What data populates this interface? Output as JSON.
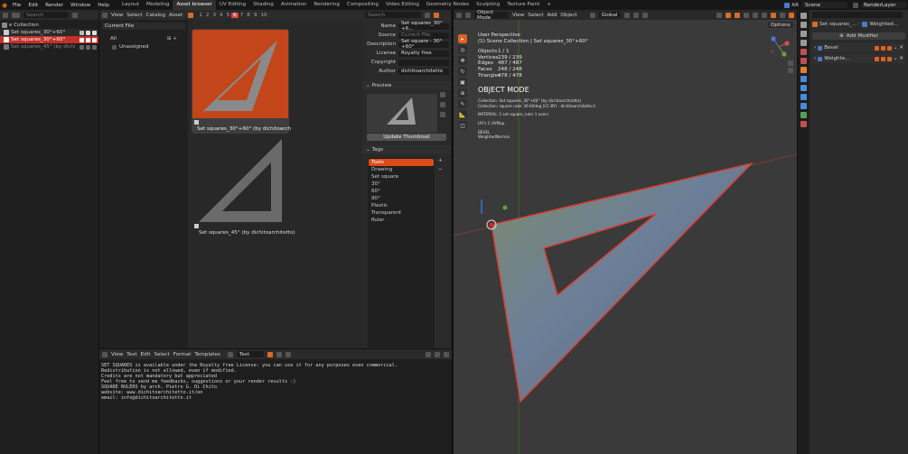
{
  "topbar": {
    "menus": [
      "File",
      "Edit",
      "Render",
      "Window",
      "Help"
    ],
    "workspaces": [
      "Layout",
      "Modeling",
      "Asset browser",
      "UV Editing",
      "Shading",
      "Animation",
      "Rendering",
      "Compositing",
      "Video Editing",
      "Geometry Nodes",
      "Sculpting",
      "Texture Paint"
    ],
    "active_workspace": "Asset browser",
    "scene": "Scene",
    "render_layer": "RenderLayer",
    "scene_prefix": "AR"
  },
  "outliner": {
    "root": "e Collection",
    "items": [
      "Set squares_30°+60°",
      "Set squares_30°+60°",
      "Set squares_45° (by dichi"
    ],
    "search_placeholder": "Search"
  },
  "asset_browser": {
    "menus": [
      "View",
      "Select",
      "Catalog",
      "Asset"
    ],
    "library": "Current File",
    "catalogs": [
      "All",
      "Unassigned"
    ],
    "frame_numbers": [
      "1",
      "2",
      "3",
      "4",
      "5",
      "6",
      "7",
      "8",
      "9",
      "10"
    ],
    "search_placeholder": "Search",
    "assets": [
      {
        "name": "Set squares_30°+60° (by dichitoarchitetto)",
        "selected": true
      },
      {
        "name": "Set squares_45° (by dichitoarchitetto)",
        "selected": false
      }
    ]
  },
  "metadata": {
    "fields": [
      {
        "label": "Name",
        "value": "Set squares_30°+6..."
      },
      {
        "label": "Source",
        "value": "Current File"
      },
      {
        "label": "Description",
        "value": "Set square - 30°+60°"
      },
      {
        "label": "License",
        "value": "Royalty free"
      },
      {
        "label": "Copyright",
        "value": ""
      },
      {
        "label": "Author",
        "value": "dichitoarchitetto"
      }
    ],
    "preview_title": "Preview",
    "update_thumbnail": "Update Thumbnail",
    "tags_title": "Tags",
    "tags": [
      "Tools",
      "Drawing",
      "Set square",
      "30°",
      "60°",
      "90°",
      "Plastic",
      "Transparent",
      "Ruler"
    ],
    "active_tag": "Tools"
  },
  "text_editor": {
    "menus": [
      "View",
      "Text",
      "Edit",
      "Select",
      "Format",
      "Templates"
    ],
    "file": "Text",
    "lines": [
      "SET SQUARES is available under the Royalty free License: you can use it for any purposes even commercial.",
      "Redistribution is not allowed, even if modified.",
      "",
      "Credits are not mandatory but appreciated",
      "",
      "Feel free to send me feedbacks, suggestions or your render results :)",
      "",
      "SQUARE RULERS by arch. Pietro G. Di Chito",
      "website: www.dichitoarchitetto.it/en",
      "email: info@dichitoarchitetto.it"
    ]
  },
  "viewport": {
    "mode": "Object Mode",
    "menus": [
      "View",
      "Select",
      "Add",
      "Object"
    ],
    "orientation": "Global",
    "options": "Options",
    "perspective": "User Perspective",
    "collection": "(1) Scene Collection | Set squares_30°+60°",
    "stats": [
      {
        "label": "Objects",
        "value": "1 / 1"
      },
      {
        "label": "Vertices",
        "value": "239 / 239"
      },
      {
        "label": "Edges",
        "value": "487 / 487"
      },
      {
        "label": "Faces",
        "value": "248 / 248"
      },
      {
        "label": "Triangles",
        "value": "478 / 478"
      }
    ],
    "mode_title": "OBJECT MODE",
    "info_lines": [
      "Collection: Set squares_30°+60° (by dichitoarchitetto)",
      "Collection: square ruler 30-60deg [CC-BY] - dichitoarchitetto.it",
      "",
      "MATERIAL: 1 set square_ruler 1 users",
      "",
      "UV's 1 UVMap",
      "",
      "BEVEL",
      "WeightedNormal"
    ]
  },
  "properties": {
    "object": "Set squares_...",
    "modifier": "Weighted...",
    "add_modifier": "Add Modifier",
    "modifiers": [
      "Bevel",
      "Weighte..."
    ]
  },
  "colors": {
    "accent": "#e0611f",
    "selection": "#ff3b30"
  }
}
